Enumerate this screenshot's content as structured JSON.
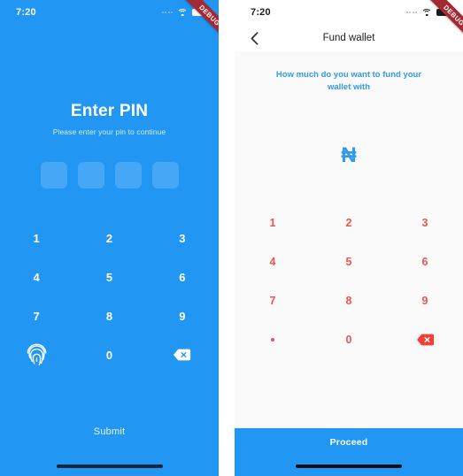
{
  "colors": {
    "brand_blue": "#2196f3",
    "pin_box_blue": "#45a7f6",
    "prompt_blue": "#2f9bea",
    "keypad_red": "#ef5350",
    "debug_red": "#a32a32",
    "screen_bg": "#fafafa"
  },
  "status_bar": {
    "time": "7:20",
    "signal_icon": "signal-dots-icon",
    "wifi_icon": "wifi-icon",
    "battery_icon": "battery-icon"
  },
  "debug_ribbon": {
    "label": "DEBUG"
  },
  "pin_screen": {
    "title": "Enter PIN",
    "subtitle": "Please enter your pin to continue",
    "pin_boxes": [
      "",
      "",
      "",
      ""
    ],
    "keypad": [
      {
        "key": "1",
        "type": "digit"
      },
      {
        "key": "2",
        "type": "digit"
      },
      {
        "key": "3",
        "type": "digit"
      },
      {
        "key": "4",
        "type": "digit"
      },
      {
        "key": "5",
        "type": "digit"
      },
      {
        "key": "6",
        "type": "digit"
      },
      {
        "key": "7",
        "type": "digit"
      },
      {
        "key": "8",
        "type": "digit"
      },
      {
        "key": "9",
        "type": "digit"
      },
      {
        "key": "fingerprint",
        "type": "icon",
        "icon": "fingerprint-icon"
      },
      {
        "key": "0",
        "type": "digit"
      },
      {
        "key": "backspace",
        "type": "icon",
        "icon": "backspace-icon"
      }
    ],
    "submit_label": "Submit"
  },
  "fund_screen": {
    "back_icon": "back-chevron-icon",
    "title": "Fund wallet",
    "prompt": "How much do you want to fund your wallet with",
    "currency_symbol": "₦",
    "amount_value": "",
    "keypad": [
      {
        "key": "1",
        "type": "digit"
      },
      {
        "key": "2",
        "type": "digit"
      },
      {
        "key": "3",
        "type": "digit"
      },
      {
        "key": "4",
        "type": "digit"
      },
      {
        "key": "5",
        "type": "digit"
      },
      {
        "key": "6",
        "type": "digit"
      },
      {
        "key": "7",
        "type": "digit"
      },
      {
        "key": "8",
        "type": "digit"
      },
      {
        "key": "9",
        "type": "digit"
      },
      {
        "key": ".",
        "type": "decimal"
      },
      {
        "key": "0",
        "type": "digit"
      },
      {
        "key": "backspace",
        "type": "icon",
        "icon": "backspace-icon"
      }
    ],
    "proceed_label": "Proceed"
  }
}
